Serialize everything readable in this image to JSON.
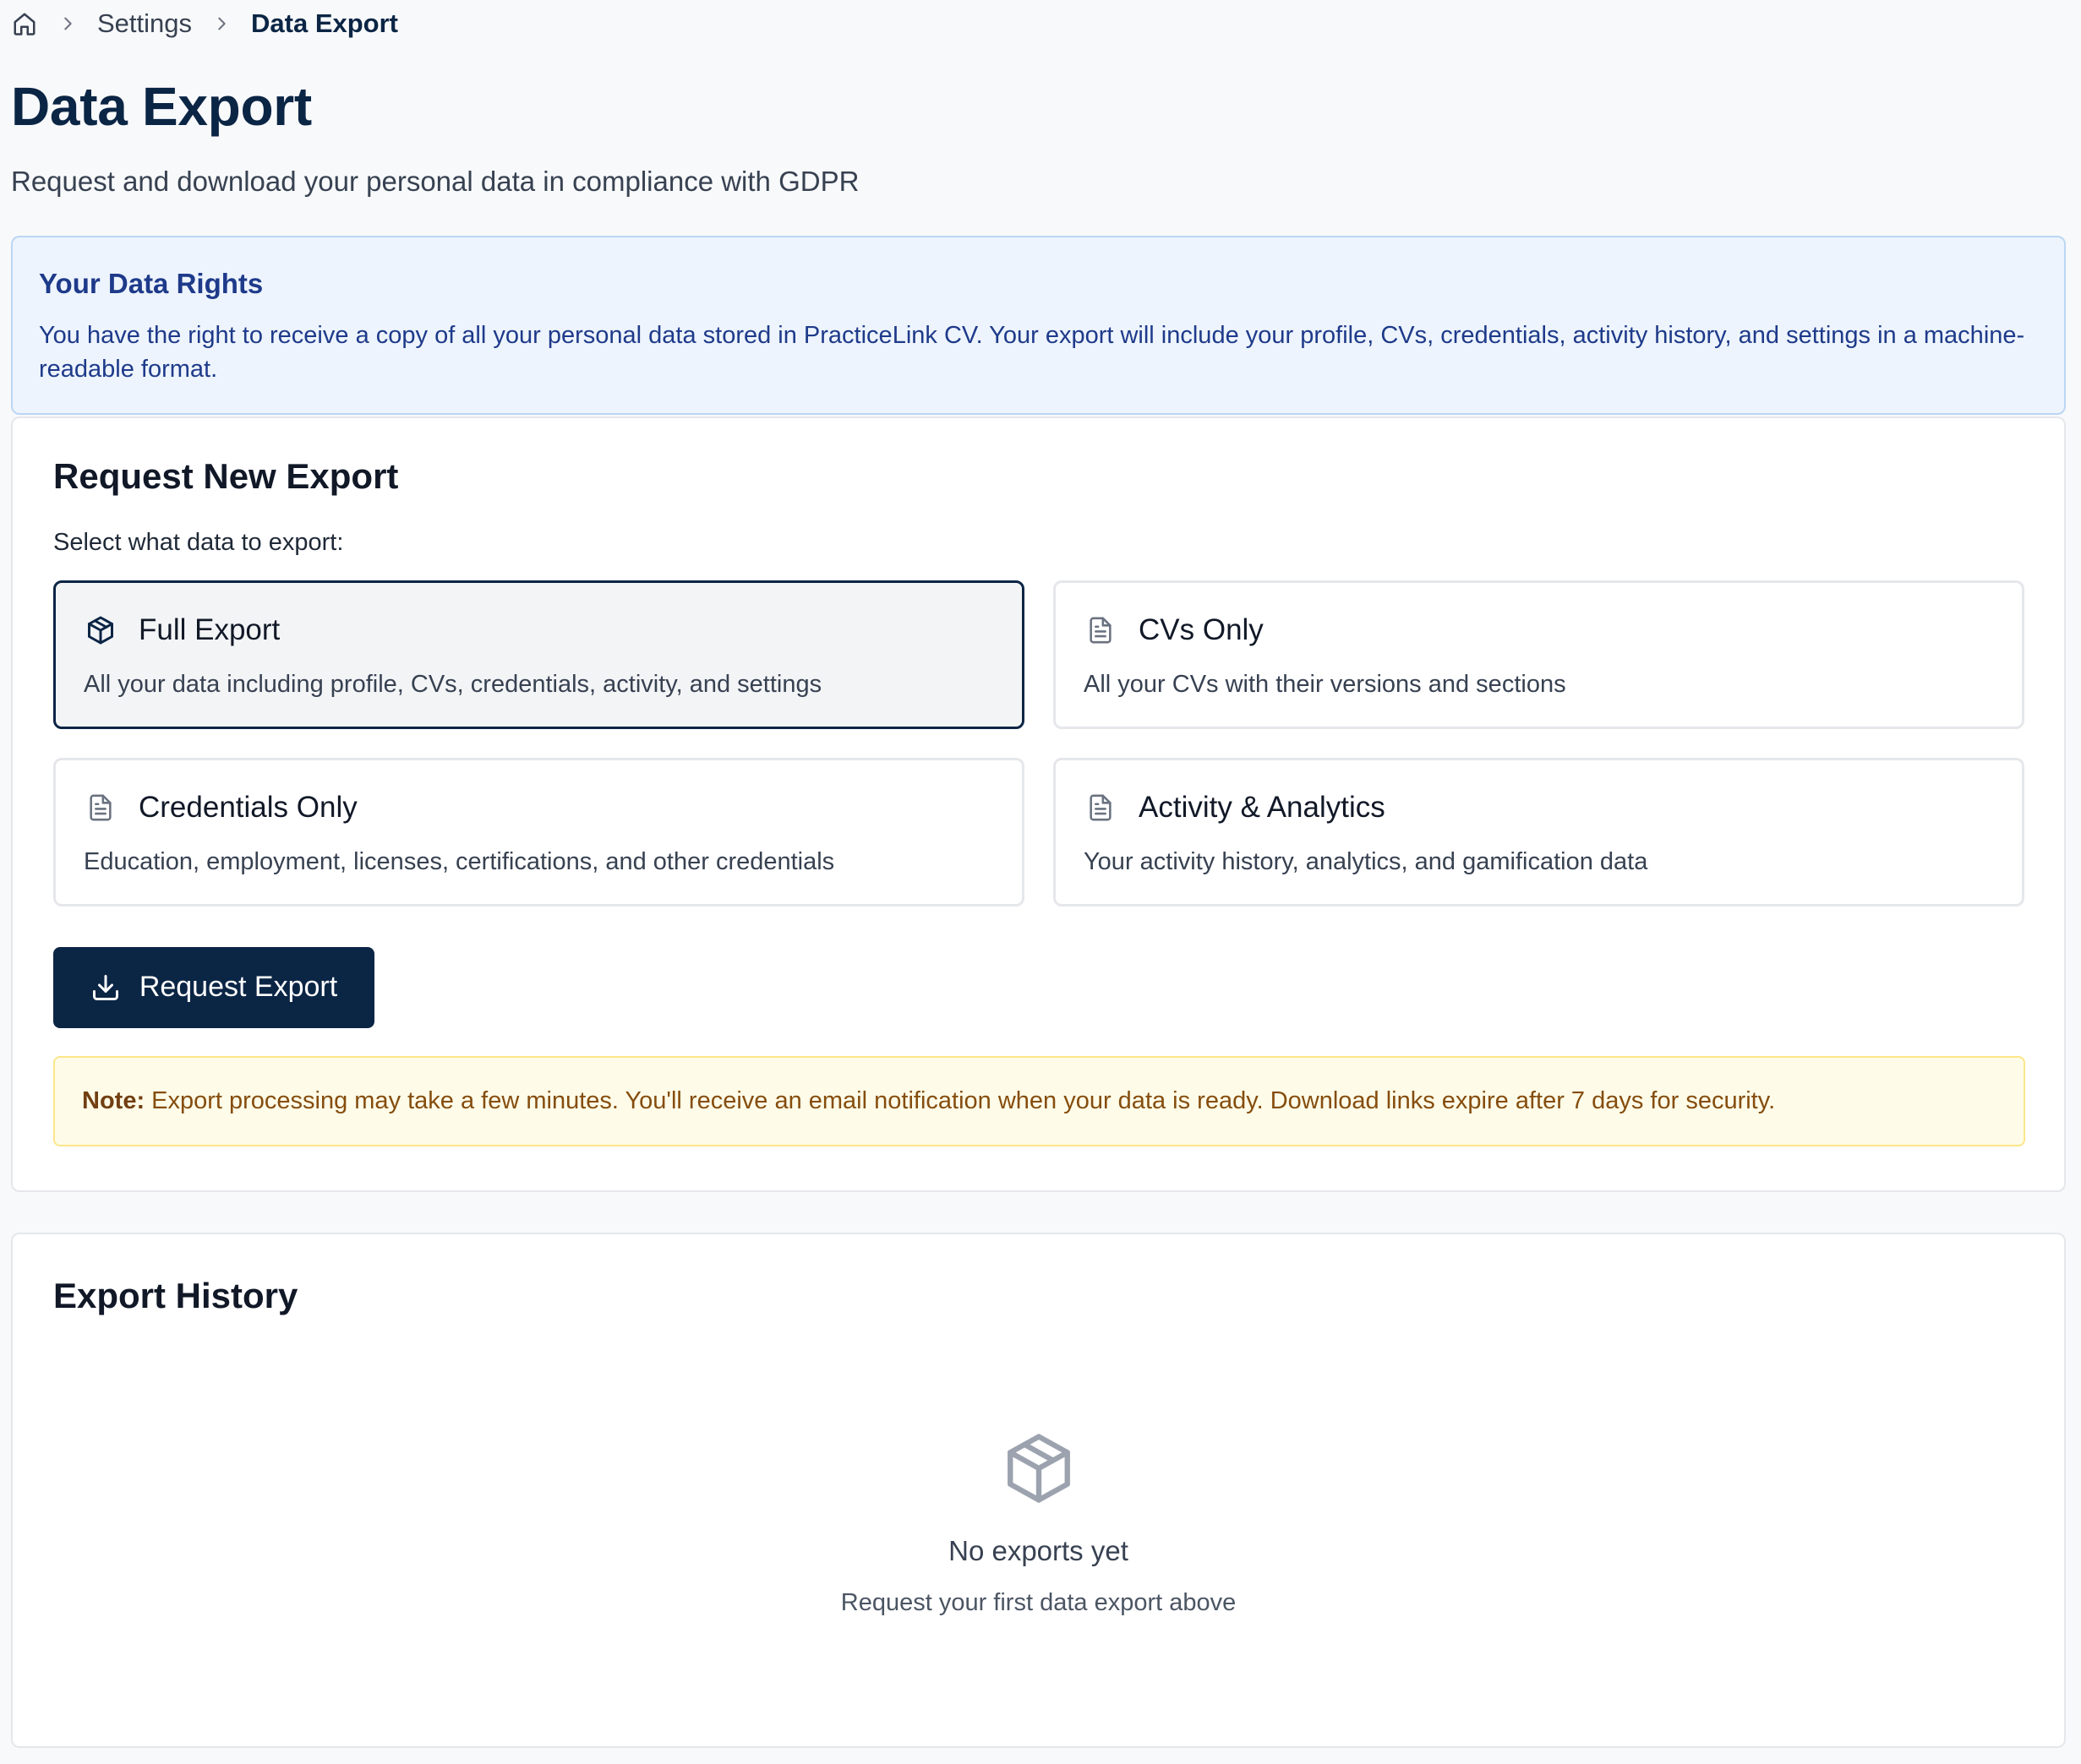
{
  "breadcrumb": {
    "home_icon": "home-icon",
    "items": [
      "Settings",
      "Data Export"
    ]
  },
  "page": {
    "title": "Data Export",
    "subtitle": "Request and download your personal data in compliance with GDPR"
  },
  "info_banner": {
    "title": "Your Data Rights",
    "text": "You have the right to receive a copy of all your personal data stored in PracticeLink CV. Your export will include your profile, CVs, credentials, activity history, and settings in a machine-readable format."
  },
  "request_card": {
    "title": "Request New Export",
    "select_label": "Select what data to export:",
    "options": [
      {
        "title": "Full Export",
        "description": "All your data including profile, CVs, credentials, activity, and settings",
        "icon": "package-icon",
        "selected": true
      },
      {
        "title": "CVs Only",
        "description": "All your CVs with their versions and sections",
        "icon": "document-icon",
        "selected": false
      },
      {
        "title": "Credentials Only",
        "description": "Education, employment, licenses, certifications, and other credentials",
        "icon": "document-icon",
        "selected": false
      },
      {
        "title": "Activity & Analytics",
        "description": "Your activity history, analytics, and gamification data",
        "icon": "document-icon",
        "selected": false
      }
    ],
    "button_label": "Request Export",
    "button_icon": "download-icon",
    "note_label": "Note:",
    "note_text": "Export processing may take a few minutes. You'll receive an email notification when your data is ready. Download links expire after 7 days for security."
  },
  "history_card": {
    "title": "Export History",
    "empty_icon": "package-icon",
    "empty_title": "No exports yet",
    "empty_subtitle": "Request your first data export above"
  },
  "colors": {
    "brand_navy": "#0b2545",
    "info_bg": "#edf4fd",
    "info_text": "#1e3a8a",
    "note_bg": "#fefce8",
    "note_text": "#854d0e"
  }
}
